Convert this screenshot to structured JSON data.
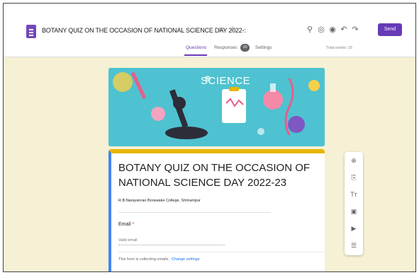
{
  "header": {
    "doc_title": "BOTANY QUIZ ON THE OCCASION OF NATIONAL SCIENCE DAY 2022-:",
    "send_label": "Send",
    "icons": {
      "folder": "folder-icon",
      "star": "star-icon",
      "palette": "palette-icon",
      "preview": "eye-icon",
      "addons": "puzzle-icon",
      "undo": "undo-icon",
      "redo": "redo-icon"
    },
    "brand_color": "#673ab7"
  },
  "tabs": {
    "questions": "Questions",
    "responses": "Responses",
    "responses_count": "10",
    "settings": "Settings",
    "total_points": "Total points: 15"
  },
  "banner": {
    "word": "SCIENCE"
  },
  "form": {
    "title": "BOTANY QUIZ ON THE OCCASION OF NATIONAL SCIENCE DAY  2022-23",
    "description": "R.B.Narayanrao Borawake College, Shrirampur",
    "email_label": "Email",
    "email_required": "*",
    "email_placeholder": "Valid email",
    "collect_note": "This form is collecting emails.",
    "collect_link": "Change settings",
    "accent_color": "#e8b500"
  },
  "side_toolbar": {
    "items": [
      {
        "name": "add-question-icon",
        "glyph": "⊕"
      },
      {
        "name": "import-questions-icon",
        "glyph": "⎘"
      },
      {
        "name": "add-title-icon",
        "glyph": "Tт"
      },
      {
        "name": "add-image-icon",
        "glyph": "▣"
      },
      {
        "name": "add-video-icon",
        "glyph": "▶"
      },
      {
        "name": "add-section-icon",
        "glyph": "☰"
      }
    ]
  }
}
